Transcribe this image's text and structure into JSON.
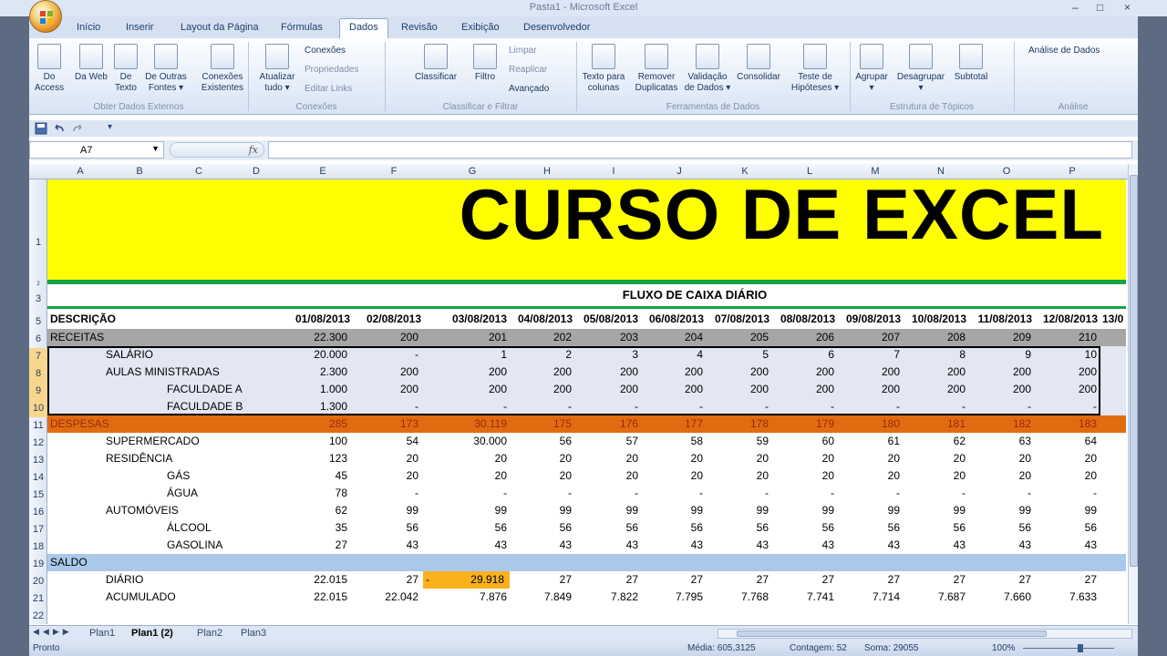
{
  "window": {
    "title": "Pasta1 - Microsoft Excel",
    "min": "–",
    "max": "□",
    "close": "×",
    "help": "?"
  },
  "tabs": [
    "Início",
    "Inserir",
    "Layout da Página",
    "Fórmulas",
    "Dados",
    "Revisão",
    "Exibição",
    "Desenvolvedor"
  ],
  "active_tab": "Dados",
  "ribbon": {
    "buttons": [
      {
        "label": "Do Access"
      },
      {
        "label": "Da Web"
      },
      {
        "label": "De Texto"
      },
      {
        "label": "De Outras Fontes ▾"
      },
      {
        "label": "Conexões Existentes"
      },
      {
        "label": "Atualizar tudo ▾"
      },
      {
        "label": "Classificar"
      },
      {
        "label": "Filtro"
      },
      {
        "label": "Texto para colunas"
      },
      {
        "label": "Remover Duplicatas"
      },
      {
        "label": "Validação de Dados ▾"
      },
      {
        "label": "Consolidar"
      },
      {
        "label": "Teste de Hipóteses ▾"
      },
      {
        "label": "Agrupar ▾"
      },
      {
        "label": "Desagrupar ▾"
      },
      {
        "label": "Subtotal"
      }
    ],
    "small": [
      "Conexões",
      "Propriedades",
      "Editar Links",
      "Limpar",
      "Reaplicar",
      "Avançado",
      "Análise de Dados"
    ],
    "groups": [
      "Obter Dados Externos",
      "Conexões",
      "Classificar e Filtrar",
      "Ferramentas de Dados",
      "Estrutura de Tópicos",
      "Análise"
    ]
  },
  "namebox": "A7",
  "fx": "fx",
  "columns": [
    "A",
    "B",
    "C",
    "D",
    "E",
    "F",
    "G",
    "H",
    "I",
    "J",
    "K",
    "L",
    "M",
    "N",
    "O",
    "P"
  ],
  "row_numbers": [
    "1",
    "2",
    "3",
    "5",
    "6",
    "7",
    "8",
    "9",
    "10",
    "11",
    "12",
    "13",
    "14",
    "15",
    "16",
    "17",
    "18",
    "19",
    "20",
    "21",
    "22"
  ],
  "banner": "CURSO DE EXCEL",
  "subtitle": "FLUXO DE CAIXA DIÁRIO",
  "dates": [
    "01/08/2013",
    "02/08/2013",
    "03/08/2013",
    "04/08/2013",
    "05/08/2013",
    "06/08/2013",
    "07/08/2013",
    "08/08/2013",
    "09/08/2013",
    "10/08/2013",
    "11/08/2013",
    "12/08/2013",
    "13/0"
  ],
  "desc_header": "DESCRIÇÃO",
  "rows": [
    {
      "label": "RECEITAS",
      "indent": 0,
      "band": "gray",
      "values": [
        "22.300",
        "200",
        "201",
        "202",
        "203",
        "204",
        "205",
        "206",
        "207",
        "208",
        "209",
        "210"
      ]
    },
    {
      "label": "SALÁRIO",
      "indent": 1,
      "band": "lav",
      "values": [
        "20.000",
        "-",
        "1",
        "2",
        "3",
        "4",
        "5",
        "6",
        "7",
        "8",
        "9",
        "10"
      ]
    },
    {
      "label": "AULAS MINISTRADAS",
      "indent": 1,
      "band": "lav",
      "values": [
        "2.300",
        "200",
        "200",
        "200",
        "200",
        "200",
        "200",
        "200",
        "200",
        "200",
        "200",
        "200"
      ]
    },
    {
      "label": "FACULDADE A",
      "indent": 2,
      "band": "lav",
      "values": [
        "1.000",
        "200",
        "200",
        "200",
        "200",
        "200",
        "200",
        "200",
        "200",
        "200",
        "200",
        "200"
      ]
    },
    {
      "label": "FACULDADE B",
      "indent": 2,
      "band": "lav",
      "values": [
        "1.300",
        "-",
        "-",
        "-",
        "-",
        "-",
        "-",
        "-",
        "-",
        "-",
        "-",
        "-"
      ]
    },
    {
      "label": "DESPESAS",
      "indent": 0,
      "band": "orange",
      "values": [
        "285",
        "173",
        "30.119",
        "175",
        "176",
        "177",
        "178",
        "179",
        "180",
        "181",
        "182",
        "183"
      ]
    },
    {
      "label": "SUPERMERCADO",
      "indent": 1,
      "band": "",
      "values": [
        "100",
        "54",
        "30.000",
        "56",
        "57",
        "58",
        "59",
        "60",
        "61",
        "62",
        "63",
        "64"
      ]
    },
    {
      "label": "RESIDÊNCIA",
      "indent": 1,
      "band": "",
      "values": [
        "123",
        "20",
        "20",
        "20",
        "20",
        "20",
        "20",
        "20",
        "20",
        "20",
        "20",
        "20"
      ]
    },
    {
      "label": "GÁS",
      "indent": 2,
      "band": "",
      "values": [
        "45",
        "20",
        "20",
        "20",
        "20",
        "20",
        "20",
        "20",
        "20",
        "20",
        "20",
        "20"
      ]
    },
    {
      "label": "ÁGUA",
      "indent": 2,
      "band": "",
      "values": [
        "78",
        "-",
        "-",
        "-",
        "-",
        "-",
        "-",
        "-",
        "-",
        "-",
        "-",
        "-"
      ]
    },
    {
      "label": "AUTOMÓVEIS",
      "indent": 1,
      "band": "",
      "values": [
        "62",
        "99",
        "99",
        "99",
        "99",
        "99",
        "99",
        "99",
        "99",
        "99",
        "99",
        "99"
      ]
    },
    {
      "label": "ÁLCOOL",
      "indent": 2,
      "band": "",
      "values": [
        "35",
        "56",
        "56",
        "56",
        "56",
        "56",
        "56",
        "56",
        "56",
        "56",
        "56",
        "56"
      ]
    },
    {
      "label": "GASOLINA",
      "indent": 2,
      "band": "",
      "values": [
        "27",
        "43",
        "43",
        "43",
        "43",
        "43",
        "43",
        "43",
        "43",
        "43",
        "43",
        "43"
      ]
    },
    {
      "label": "SALDO",
      "indent": 0,
      "band": "blue",
      "values": []
    },
    {
      "label": "DIÁRIO",
      "indent": 1,
      "band": "",
      "values": [
        "22.015",
        "27",
        "- 29.918",
        "27",
        "27",
        "27",
        "27",
        "27",
        "27",
        "27",
        "27",
        "27"
      ]
    },
    {
      "label": "ACUMULADO",
      "indent": 1,
      "band": "",
      "values": [
        "22.015",
        "22.042",
        "7.876",
        "7.849",
        "7.822",
        "7.795",
        "7.768",
        "7.741",
        "7.714",
        "7.687",
        "7.660",
        "7.633"
      ]
    }
  ],
  "sheet_tabs": [
    "Plan1",
    "Plan1 (2)",
    "Plan2",
    "Plan3"
  ],
  "active_sheet": "Plan1 (2)",
  "status": {
    "ready": "Pronto",
    "media": "Média: 605,3125",
    "contagem": "Contagem: 52",
    "soma": "Soma: 29055",
    "zoom": "100%"
  }
}
